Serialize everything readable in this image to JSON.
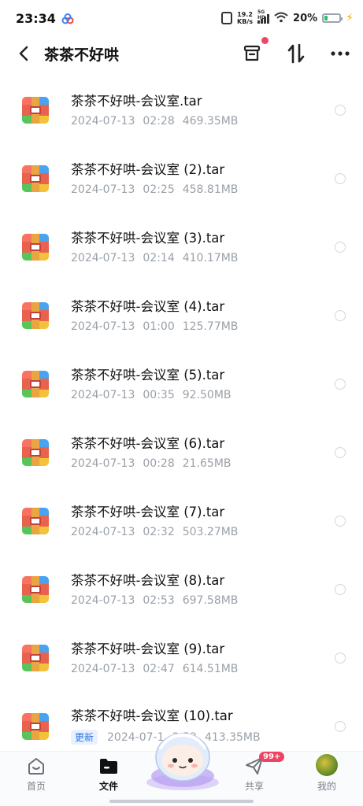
{
  "status_bar": {
    "time": "23:34",
    "net_speed_value": "19.2",
    "net_speed_unit": "KB/s",
    "network_type": "5G HD",
    "battery_percent": "20%",
    "battery_level": 0.2,
    "colors": {
      "battery": "#22c55e",
      "charging": "#eab308"
    }
  },
  "header": {
    "title": "茶茶不好哄",
    "icons": [
      "back-icon",
      "archive-icon",
      "sort-icon",
      "more-icon"
    ],
    "has_notification_dot": true
  },
  "files": [
    {
      "name": "茶茶不好哄-会议室.tar",
      "date": "2024-07-13",
      "time": "02:28",
      "size": "469.35MB"
    },
    {
      "name": "茶茶不好哄-会议室 (2).tar",
      "date": "2024-07-13",
      "time": "02:25",
      "size": "458.81MB"
    },
    {
      "name": "茶茶不好哄-会议室 (3).tar",
      "date": "2024-07-13",
      "time": "02:14",
      "size": "410.17MB"
    },
    {
      "name": "茶茶不好哄-会议室 (4).tar",
      "date": "2024-07-13",
      "time": "01:00",
      "size": "125.77MB"
    },
    {
      "name": "茶茶不好哄-会议室 (5).tar",
      "date": "2024-07-13",
      "time": "00:35",
      "size": "92.50MB"
    },
    {
      "name": "茶茶不好哄-会议室 (6).tar",
      "date": "2024-07-13",
      "time": "00:28",
      "size": "21.65MB"
    },
    {
      "name": "茶茶不好哄-会议室 (7).tar",
      "date": "2024-07-13",
      "time": "02:32",
      "size": "503.27MB"
    },
    {
      "name": "茶茶不好哄-会议室 (8).tar",
      "date": "2024-07-13",
      "time": "02:53",
      "size": "697.58MB"
    },
    {
      "name": "茶茶不好哄-会议室 (9).tar",
      "date": "2024-07-13",
      "time": "02:47",
      "size": "614.51MB"
    },
    {
      "name": "茶茶不好哄-会议室 (10).tar",
      "badge": "更新",
      "date": "2024-07-1",
      "time": "3:53",
      "size": "413.35MB"
    }
  ],
  "bottom_nav": {
    "items": [
      {
        "label": "首页",
        "icon": "home-icon",
        "active": false
      },
      {
        "label": "文件",
        "icon": "folder-icon",
        "active": true
      },
      {
        "label": "",
        "icon": "mascot-icon",
        "active": false
      },
      {
        "label": "共享",
        "icon": "send-icon",
        "active": false,
        "badge": "99+"
      },
      {
        "label": "我的",
        "icon": "avatar",
        "active": false
      }
    ],
    "colors": {
      "badge": "#f04262",
      "active": "#111111"
    }
  }
}
